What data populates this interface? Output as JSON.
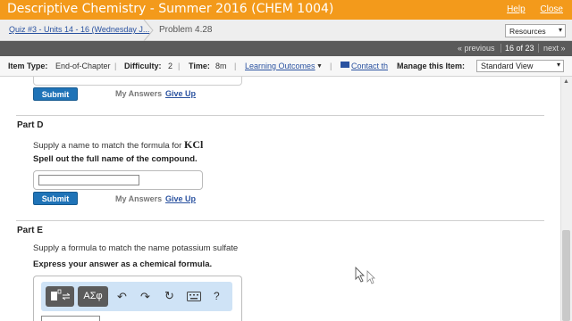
{
  "app": {
    "title": "Descriptive Chemistry - Summer 2016 (CHEM 1004)",
    "help_label": "Help",
    "close_label": "Close"
  },
  "breadcrumb": {
    "quiz_label": "Quiz #3 - Units 14 - 16 (Wednesday J...",
    "problem_label": "Problem 4.28",
    "resources_label": "Resources"
  },
  "nav": {
    "previous_label": "« previous",
    "position": "16 of 23",
    "next_label": "next »"
  },
  "info": {
    "item_type_label": "Item Type:",
    "item_type_value": "End-of-Chapter",
    "difficulty_label": "Difficulty:",
    "difficulty_value": "2",
    "time_label": "Time:",
    "time_value": "8m",
    "learning_outcomes_label": "Learning Outcomes",
    "contact_label": "Contact th",
    "manage_label": "Manage this Item:",
    "view_select_value": "Standard View"
  },
  "common": {
    "submit_label": "Submit",
    "my_answers_label": "My Answers",
    "give_up_label": "Give Up"
  },
  "part_d": {
    "title": "Part D",
    "prompt": "Supply a name to match the formula for",
    "formula": "KCl",
    "instruction": "Spell out the full name of the compound.",
    "answer_value": ""
  },
  "part_e": {
    "title": "Part E",
    "prompt": "Supply a formula to match the name potassium sulfate",
    "instruction": "Express your answer as a chemical formula.",
    "toolbar": {
      "greek_label": "ΑΣφ",
      "help_label": "?"
    }
  },
  "colors": {
    "brand_orange": "#f39a1b",
    "submit_blue": "#1f73b7",
    "link_blue": "#2a52a0",
    "toolbar_blue": "#cfe3f6"
  },
  "icons": [
    "template-icon",
    "undo-icon",
    "redo-icon",
    "reset-icon",
    "keyboard-icon",
    "help-icon",
    "mail-icon",
    "cursor-icon"
  ]
}
